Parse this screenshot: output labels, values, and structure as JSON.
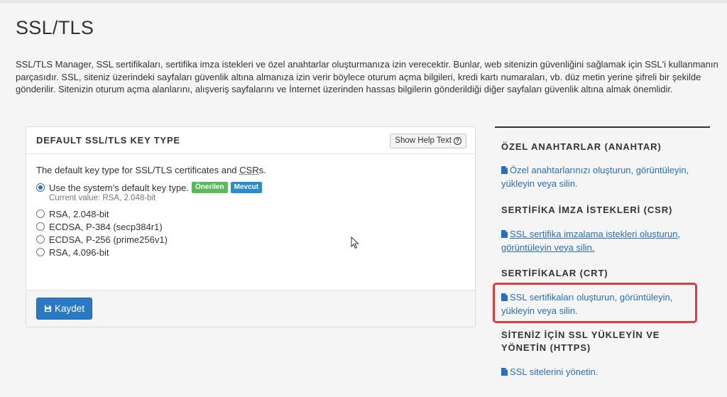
{
  "page": {
    "title": "SSL/TLS",
    "intro": "SSL/TLS Manager, SSL sertifikaları, sertifika imza istekleri ve özel anahtarlar oluşturmanıza izin verecektir. Bunlar, web sitenizin güvenliğini sağlamak için SSL'i kullanmanın parçasıdır. SSL, siteniz üzerindeki sayfaları güvenlik altına almanıza izin verir böylece oturum açma bilgileri, kredi kartı numaraları, vb. düz metin yerine şifreli bir şekilde gönderilir. Sitenizin oturum açma alanlarını, alışveriş sayfalarını ve İnternet üzerinden hassas bilgilerin gönderildiği diğer sayfaları güvenlik altına almak önemlidir."
  },
  "panel": {
    "title": "DEFAULT SSL/TLS KEY TYPE",
    "help_label": "Show Help Text",
    "desc_prefix": "The default key type for SSL/TLS certificates and ",
    "desc_abbr": "CSR",
    "desc_suffix": "s.",
    "options": [
      {
        "label": "Use the system’s default key type.",
        "checked": true
      },
      {
        "label": "RSA, 2.048-bit",
        "checked": false
      },
      {
        "label": "ECDSA, P-384 (secp384r1)",
        "checked": false
      },
      {
        "label": "ECDSA, P-256 (prime256v1)",
        "checked": false
      },
      {
        "label": "RSA, 4.096-bit",
        "checked": false
      }
    ],
    "badge_recommended": "Önerilen",
    "badge_current": "Mevcut",
    "current_value": "Current value: RSA, 2.048-bit",
    "save_label": "Kaydet"
  },
  "sidebar": {
    "sections": [
      {
        "title": "ÖZEL ANAHTARLAR (ANAHTAR)",
        "link_line1": "Özel anahtarlarınızı oluşturun, görüntüleyin,",
        "link_line2": "yükleyin veya silin."
      },
      {
        "title": "SERTİFİKA İMZA İSTEKLERİ (CSR)",
        "link_line1": "SSL sertifika imzalama istekleri oluşturun,",
        "link_line2": "görüntüleyin veya silin."
      },
      {
        "title": "SERTİFİKALAR (CRT)",
        "link_line1": "SSL sertifikaları oluşturun, görüntüleyin,",
        "link_line2": "yükleyin veya silin."
      },
      {
        "title_line1": "SİTENİZ İÇİN SSL YÜKLEYİN VE",
        "title_line2": "YÖNETİN (HTTPS)",
        "link_line1": "SSL sitelerini yönetin."
      }
    ]
  },
  "colors": {
    "link": "#2a6ebb",
    "primary_button": "#2a79c5",
    "badge_green": "#5cb85c",
    "badge_blue": "#2b8ccb",
    "highlight": "#e03c3c"
  }
}
